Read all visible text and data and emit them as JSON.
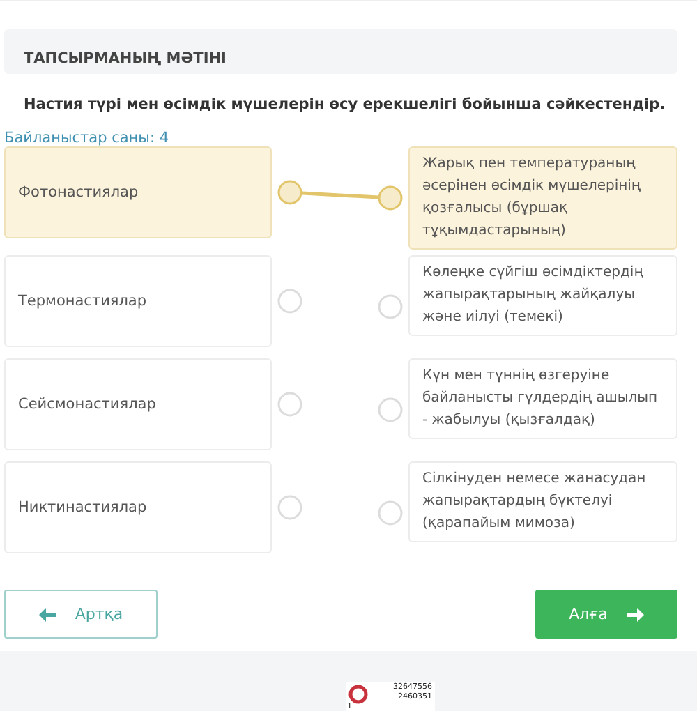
{
  "section_title": "ТАПСЫРМАНЫҢ МӘТІНІ",
  "question": "Настия түрі мен өсімдік мүшелерін өсу ерекшелігі бойынша сәйкестендір.",
  "connections_count": "Байланыстар саны: 4",
  "left_items": [
    {
      "label": "Фотонастиялар",
      "selected": true,
      "linked": true
    },
    {
      "label": "Термонастиялар",
      "selected": false,
      "linked": false
    },
    {
      "label": "Сейсмонастиялар",
      "selected": false,
      "linked": false
    },
    {
      "label": "Никтинастиялар",
      "selected": false,
      "linked": false
    }
  ],
  "right_items": [
    {
      "label": "Жарық пен температураның әсерінен өсімдік мүшелерінің қозғалысы (бұршақ тұқымдастарының)",
      "selected": true
    },
    {
      "label": "Көлеңке сүйгіш өсімдіктердің жапырақтарының жайқалуы және иілуі (темекі)",
      "selected": false
    },
    {
      "label": "Күн мен түннің өзгеруіне байланысты гүлдердің ашылып - жабылуы (қызғалдақ)",
      "selected": false
    },
    {
      "label": "Сілкінуден немесе жанасудан жапырақтардың бүктелуі (қарапайым мимоза)",
      "selected": false
    }
  ],
  "buttons": [
    {
      "kind": "back",
      "label": "Артқа"
    },
    {
      "kind": "next",
      "label": "Алға"
    }
  ],
  "counter": {
    "line_1": "32647556",
    "line_2": "2460351",
    "line_3": "1"
  }
}
